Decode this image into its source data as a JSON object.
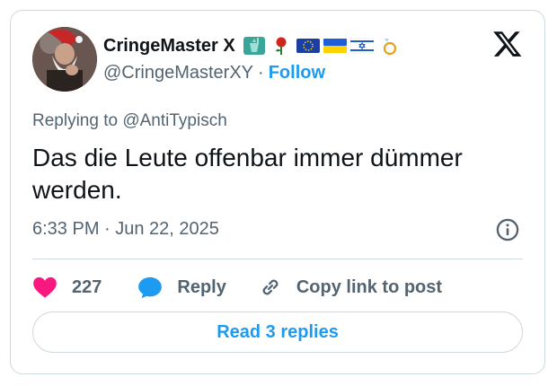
{
  "author": {
    "display_name": "CringeMaster X",
    "handle": "@CringeMasterXY",
    "separator": "·",
    "follow_label": "Follow",
    "badges": [
      "statue-of-liberty-emoji",
      "rose-emoji",
      "eu-flag-emoji",
      "ukraine-flag-emoji",
      "israel-flag-emoji",
      "ring-emoji"
    ]
  },
  "tweet": {
    "replying_prefix": "Replying to ",
    "replying_to": "@AntiTypisch",
    "text": "Das die Leute offenbar immer dümmer werden.",
    "timestamp": "6:33 PM · Jun 22, 2025"
  },
  "actions": {
    "likes": "227",
    "reply_label": "Reply",
    "copy_label": "Copy link to post"
  },
  "read_replies_label": "Read 3 replies",
  "colors": {
    "accent": "#1d9bf0",
    "like": "#f91880",
    "text": "#0f1419",
    "muted": "#536471",
    "border": "#cfd9de"
  }
}
